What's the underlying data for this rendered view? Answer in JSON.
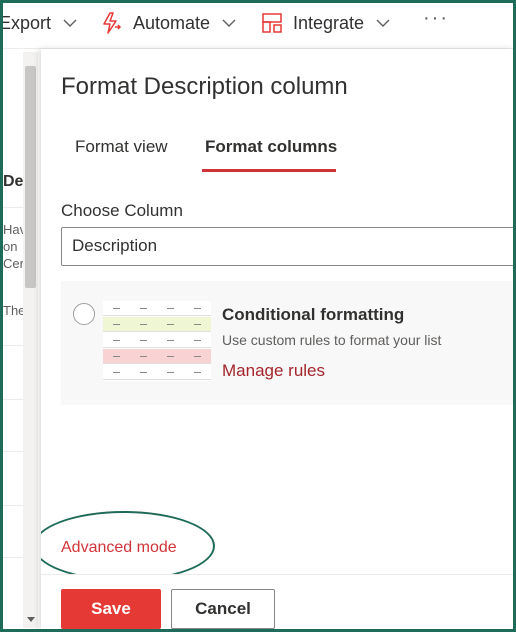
{
  "commandbar": {
    "export_label": "Export",
    "automate_label": "Automate",
    "integrate_label": "Integrate",
    "more_label": "···",
    "icons": {
      "automate": "lightning-flow-icon",
      "integrate": "integrate-grid-icon",
      "chevron": "chevron-down-icon"
    },
    "accent": "#e53935"
  },
  "background_list": {
    "header": "De",
    "rows": [
      {
        "lines": [
          "Hav",
          "on",
          "Cer"
        ]
      },
      {
        "lines": [
          "The"
        ]
      }
    ]
  },
  "panel": {
    "title": "Format Description column",
    "tabs": [
      {
        "label": "Format view",
        "selected": false
      },
      {
        "label": "Format columns",
        "selected": true
      }
    ],
    "choose_column_label": "Choose Column",
    "column_value": "Description",
    "conditional": {
      "title": "Conditional formatting",
      "description": "Use custom rules to format your list",
      "manage_link": "Manage rules",
      "preview_row_colors": [
        "#ffffff",
        "#eef6d4",
        "#ffffff",
        "#f9d2d4",
        "#ffffff"
      ]
    },
    "advanced_mode": "Advanced mode",
    "footer": {
      "save_label": "Save",
      "cancel_label": "Cancel"
    }
  },
  "colors": {
    "primary_button": "#e53935",
    "link": "#a4262c",
    "tab_underline": "#d13438",
    "highlight_ring": "#1f6b59"
  }
}
